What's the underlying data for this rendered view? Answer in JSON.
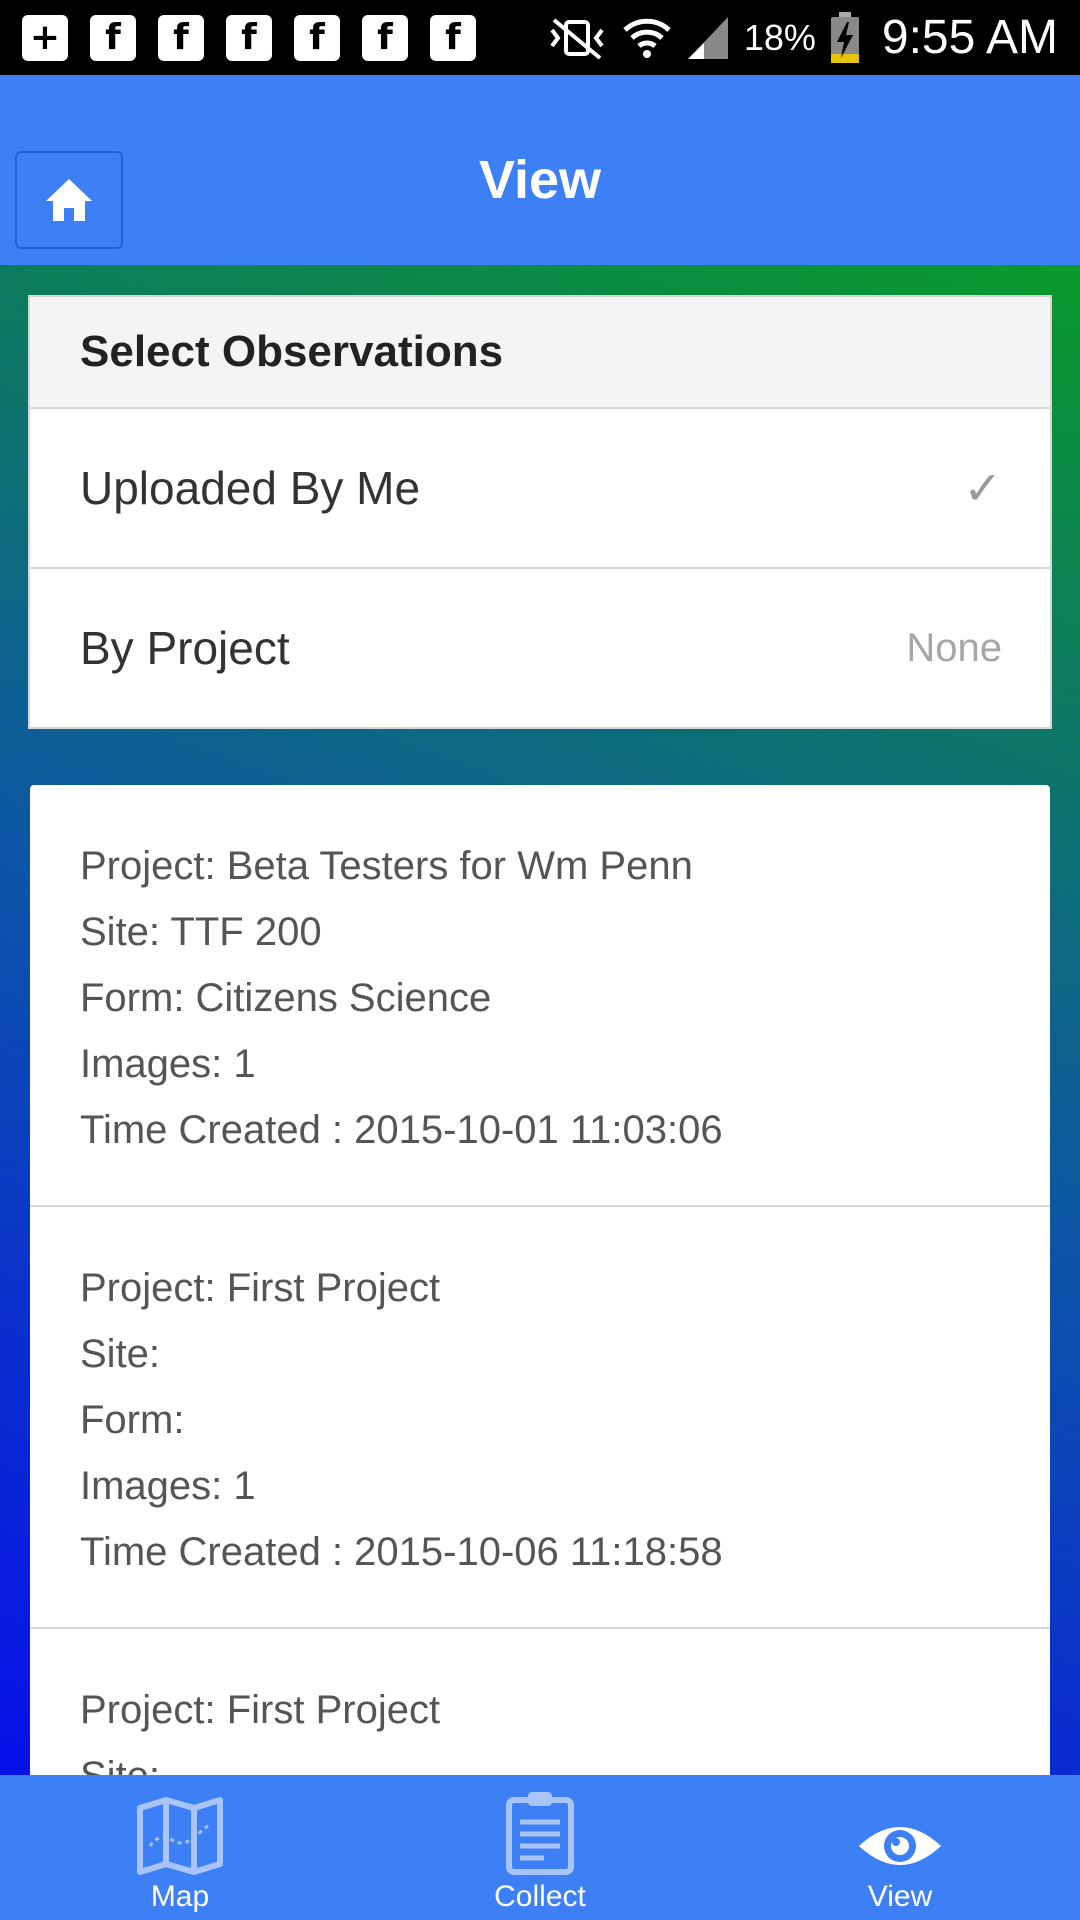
{
  "status_bar": {
    "left_icons": [
      "plus-box-icon",
      "flipboard-icon",
      "flipboard-icon",
      "flipboard-icon",
      "flipboard-icon",
      "flipboard-icon",
      "flipboard-icon"
    ],
    "battery_percent": "18%",
    "time": "9:55 AM"
  },
  "header": {
    "title": "View",
    "home_icon": "home-icon"
  },
  "select_panel": {
    "title": "Select Observations",
    "rows": [
      {
        "label": "Uploaded By Me",
        "value": "✓"
      },
      {
        "label": "By Project",
        "value": "None"
      }
    ]
  },
  "observations": [
    {
      "project": "Project: Beta Testers for Wm Penn",
      "site": "Site: TTF 200",
      "form": "Form: Citizens Science",
      "images": "Images: 1",
      "time_created": "Time Created : 2015-10-01 11:03:06"
    },
    {
      "project": "Project: First Project",
      "site": "Site:",
      "form": "Form:",
      "images": "Images: 1",
      "time_created": "Time Created : 2015-10-06 11:18:58"
    },
    {
      "project": "Project: First Project",
      "site": "Site:"
    }
  ],
  "tabs": [
    {
      "label": "Map",
      "icon": "map-icon"
    },
    {
      "label": "Collect",
      "icon": "clipboard-icon"
    },
    {
      "label": "View",
      "icon": "eye-icon"
    }
  ],
  "colors": {
    "primary": "#3d80f5",
    "tab_icon": "#a9c5f7"
  }
}
